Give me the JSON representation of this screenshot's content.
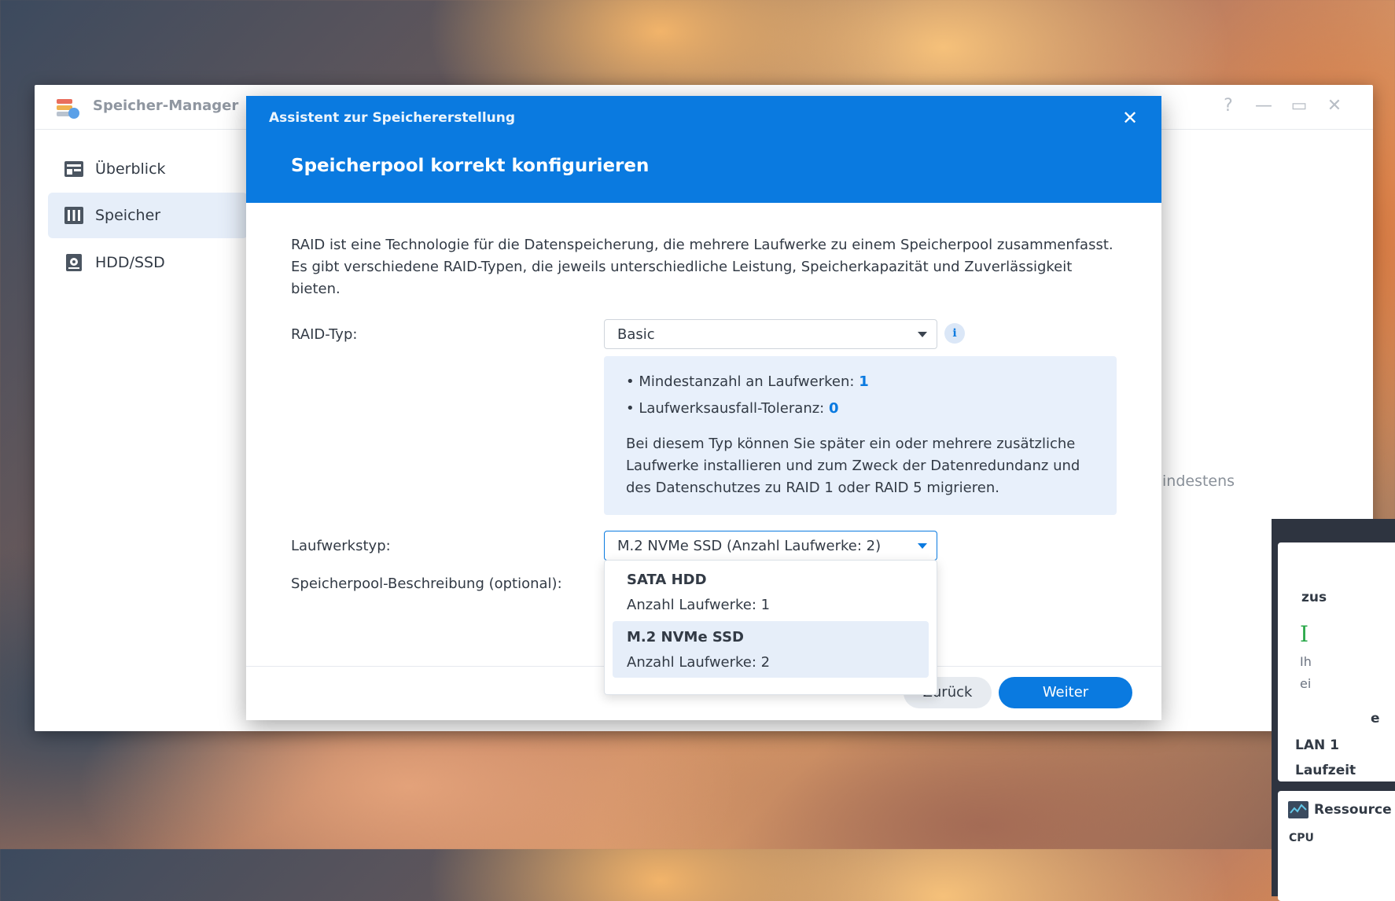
{
  "app": {
    "title": "Speicher-Manager",
    "window_controls": [
      "?",
      "—",
      "▭",
      "✕"
    ]
  },
  "sidebar": {
    "items": [
      {
        "label": "Überblick",
        "icon": "overview-icon",
        "active": false
      },
      {
        "label": "Speicher",
        "icon": "storage-icon",
        "active": true
      },
      {
        "label": "HDD/SSD",
        "icon": "disk-icon",
        "active": false
      }
    ]
  },
  "background": {
    "partial_text": "indestens",
    "right_panel": {
      "partial_heading": "zus",
      "green_letter": "I",
      "partial_lines": [
        "Ih",
        "ei"
      ],
      "partial_e": "e",
      "lan_label": "LAN 1",
      "uptime_label": "Laufzeit",
      "resource_label": "Ressource",
      "cpu_label": "CPU"
    }
  },
  "dialog": {
    "wizard_title": "Assistent zur Speichererstellung",
    "close_icon": "close-icon",
    "step_title": "Speicherpool korrekt konfigurieren",
    "intro": "RAID ist eine Technologie für die Datenspeicherung, die mehrere Laufwerke zu einem Speicherpool zusammenfasst. Es gibt verschiedene RAID-Typen, die jeweils unterschiedliche Leistung, Speicherkapazität und Zuverlässigkeit bieten.",
    "raid_label": "RAID-Typ:",
    "raid_value": "Basic",
    "info": {
      "min_drives_label": "Mindestanzahl an Laufwerken:",
      "min_drives_value": "1",
      "tolerance_label": "Laufwerksausfall-Toleranz:",
      "tolerance_value": "0",
      "description": "Bei diesem Typ können Sie später ein oder mehrere zusätzliche Laufwerke installieren und zum Zweck der Datenredundanz und des Datenschutzes zu RAID 1 oder RAID 5 migrieren."
    },
    "drive_type_label": "Laufwerkstyp:",
    "drive_type_value": "M.2 NVMe SSD (Anzahl Laufwerke:  2)",
    "description_label": "Speicherpool-Beschreibung (optional):",
    "dropdown_options": [
      {
        "name": "SATA HDD",
        "sub": "Anzahl Laufwerke: 1",
        "selected": false
      },
      {
        "name": "M.2 NVMe SSD",
        "sub": "Anzahl Laufwerke: 2",
        "selected": true
      }
    ],
    "back_button": "Zurück",
    "next_button": "Weiter"
  },
  "colors": {
    "accent": "#0a7ae0",
    "selected_bg": "#e6eef9",
    "info_bg": "#e8f0fb"
  }
}
